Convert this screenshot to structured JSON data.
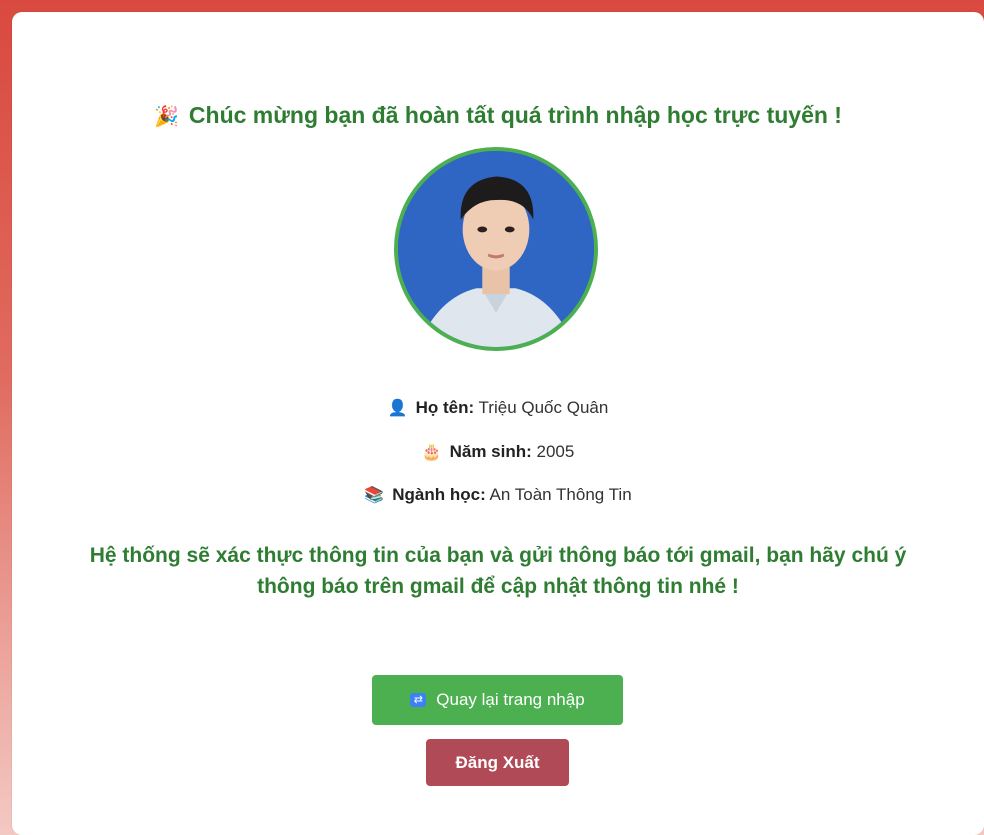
{
  "header": {
    "congrats_icon": "party-popper-icon",
    "congrats_text": "Chúc mừng bạn đã hoàn tất quá trình nhập học trực tuyến !"
  },
  "profile": {
    "avatar": "student-portrait",
    "name_label": "Họ tên:",
    "name_value": " Triệu Quốc Quân",
    "birth_label": "Năm sinh:",
    "birth_value": " 2005",
    "major_label": "Ngành học:",
    "major_value": " An Toàn Thông Tin"
  },
  "notice": {
    "text": "Hệ thống sẽ xác thực thông tin của bạn và gửi thông báo tới gmail, bạn hãy chú ý thông báo trên gmail để cập nhật thông tin nhé !"
  },
  "actions": {
    "back_label": "Quay lại trang nhập",
    "logout_label": "Đăng Xuất"
  },
  "colors": {
    "accent_green": "#2e7d32",
    "button_green": "#4caf50",
    "button_logout": "#b14a57",
    "frame_red": "#d9493f"
  }
}
